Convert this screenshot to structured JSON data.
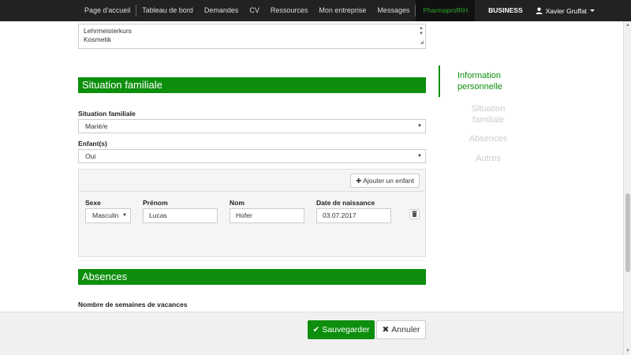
{
  "nav": {
    "items": [
      "Page d'accueil",
      "Tableau de bord",
      "Demandes",
      "CV",
      "Ressources",
      "Mon entreprise",
      "Messages"
    ],
    "brand": "PharmaprofRH",
    "business": "BUSINESS",
    "user": "Xavier Gruffat"
  },
  "textarea": {
    "lines": [
      "Lehrmeisterkurs",
      "Kosmetik"
    ]
  },
  "sections": {
    "family": "Situation familiale",
    "absences": "Absences"
  },
  "family": {
    "status_label": "Situation familiale",
    "status_value": "Marié/e",
    "children_label": "Enfant(s)",
    "children_value": "Oui",
    "add_child_label": "Ajouter un enfant"
  },
  "child": {
    "sex_label": "Sexe",
    "sex_value": "Masculin",
    "firstname_label": "Prénom",
    "firstname_value": "Lucas",
    "lastname_label": "Nom",
    "lastname_value": "Hofer",
    "birthdate_label": "Date de naissance",
    "birthdate_value": "03.07.2017"
  },
  "absences": {
    "vacation_label": "Nombre de semaines de vacances"
  },
  "sidenav": {
    "active": "Information personnelle",
    "items": [
      "Situation familiale",
      "Absences",
      "Autres"
    ]
  },
  "footer": {
    "save_label": "Sauvegarder",
    "cancel_label": "Annuler"
  },
  "colors": {
    "accent": "#0d8f0d",
    "navbar": "#222222"
  }
}
